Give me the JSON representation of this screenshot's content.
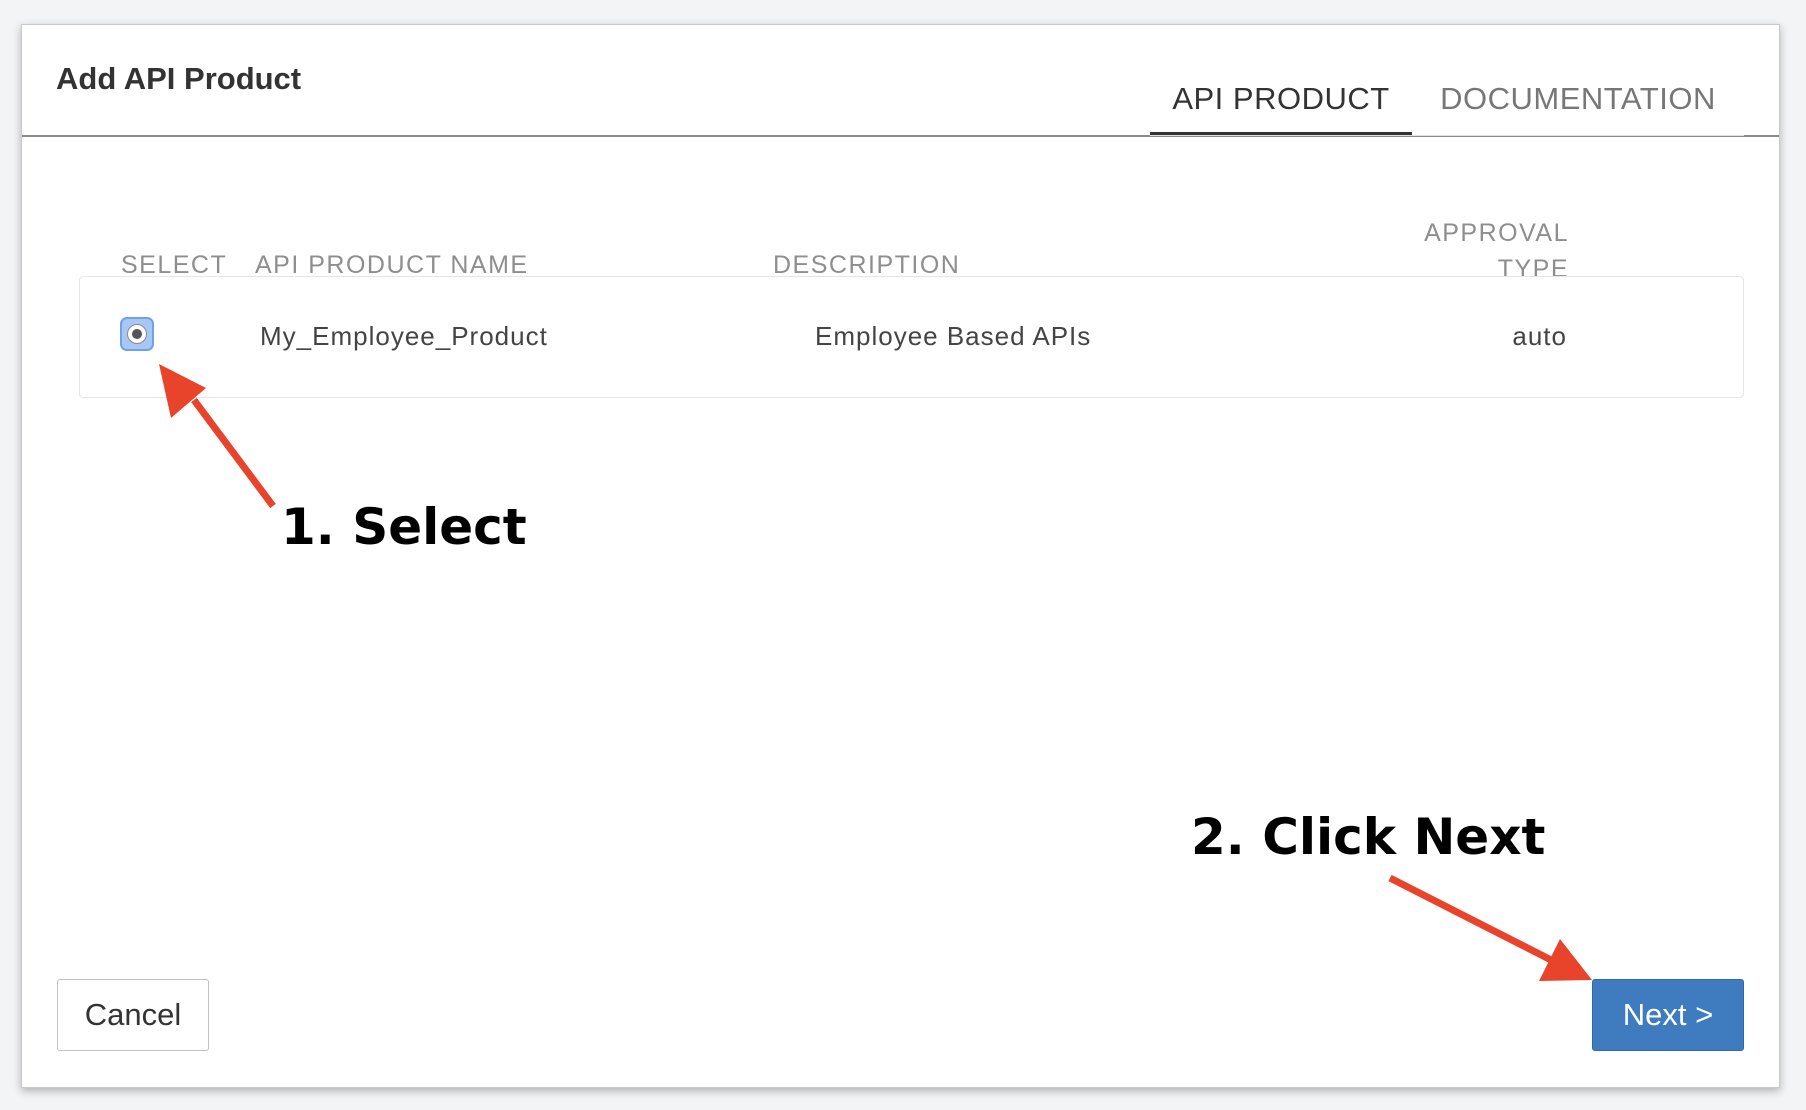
{
  "dialog": {
    "title": "Add API Product",
    "tabs": [
      {
        "label": "API PRODUCT",
        "active": true
      },
      {
        "label": "DOCUMENTATION",
        "active": false
      }
    ]
  },
  "table": {
    "headers": {
      "select": "SELECT",
      "name": "API PRODUCT NAME",
      "description": "DESCRIPTION",
      "approval_line1": "APPROVAL",
      "approval_line2": "TYPE"
    },
    "rows": [
      {
        "selected": true,
        "name": "My_Employee_Product",
        "description": "Employee Based APIs",
        "approval_type": "auto"
      }
    ]
  },
  "buttons": {
    "cancel_label": "Cancel",
    "next_label": "Next >"
  },
  "annotations": {
    "step1": "1. Select",
    "step2": "2. Click Next",
    "arrow_color": "#e8432b"
  },
  "colors": {
    "primary_button": "#3f7bbf",
    "radio_focus": "#a9c7f5"
  }
}
